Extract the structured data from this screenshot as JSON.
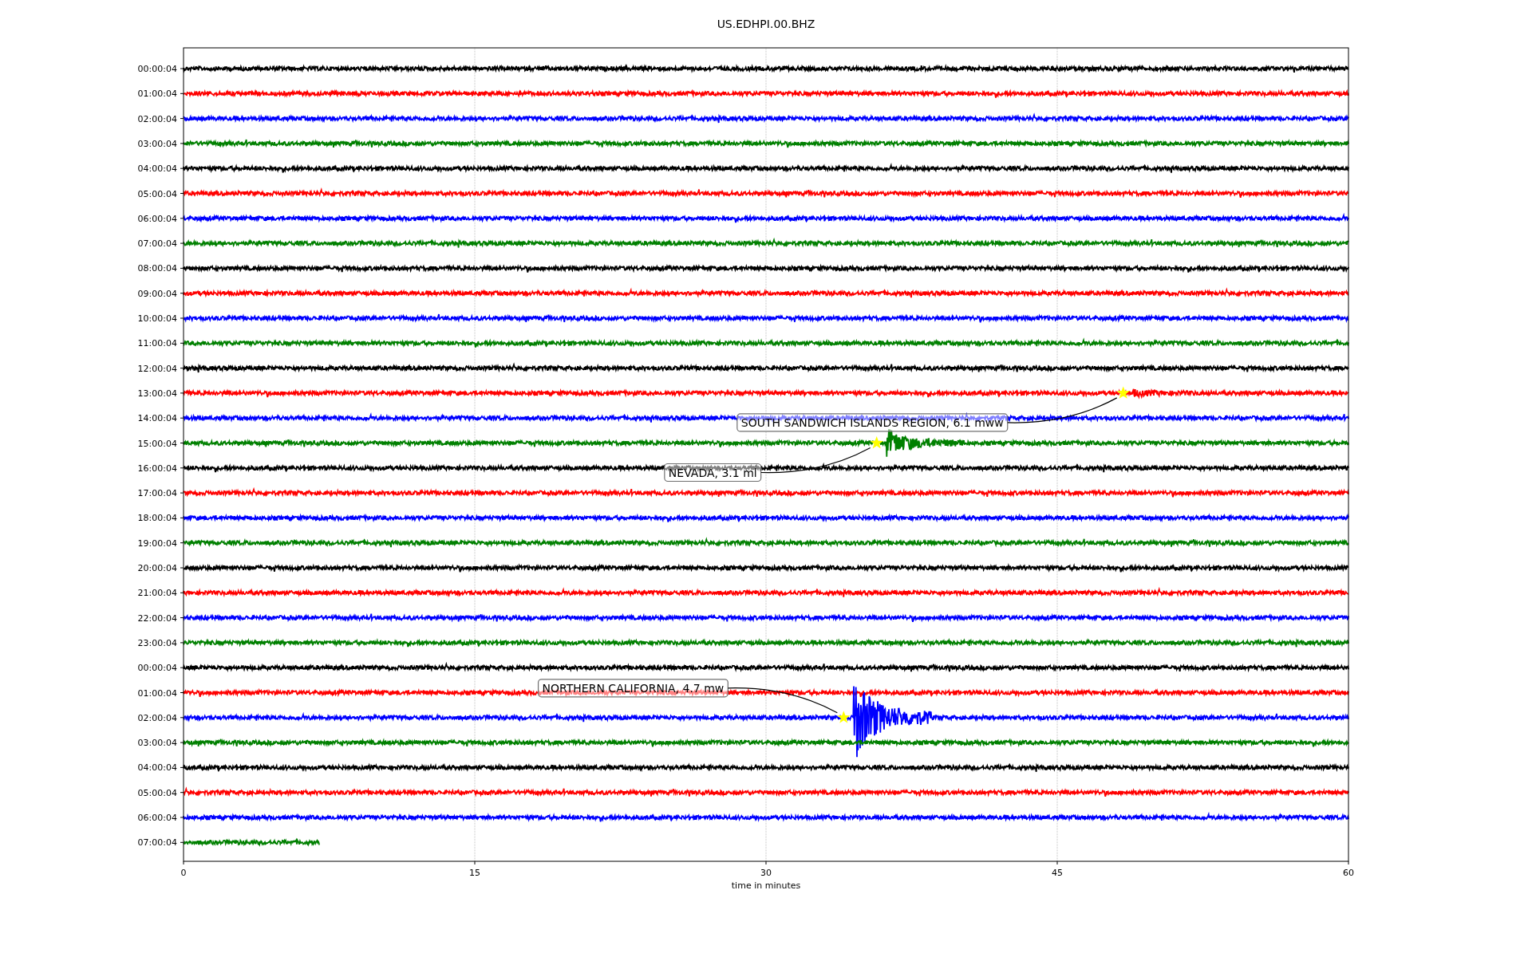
{
  "figure": {
    "title": "US.EDHPI.00.BHZ",
    "xlabel": "time in minutes",
    "xticks": [
      "0",
      "15",
      "30",
      "45",
      "60"
    ],
    "traces": [
      {
        "label": "00:00:04",
        "color": "#000000"
      },
      {
        "label": "01:00:04",
        "color": "#ff0000"
      },
      {
        "label": "02:00:04",
        "color": "#0000ff"
      },
      {
        "label": "03:00:04",
        "color": "#008000"
      },
      {
        "label": "04:00:04",
        "color": "#000000"
      },
      {
        "label": "05:00:04",
        "color": "#ff0000"
      },
      {
        "label": "06:00:04",
        "color": "#0000ff"
      },
      {
        "label": "07:00:04",
        "color": "#008000"
      },
      {
        "label": "08:00:04",
        "color": "#000000"
      },
      {
        "label": "09:00:04",
        "color": "#ff0000"
      },
      {
        "label": "10:00:04",
        "color": "#0000ff"
      },
      {
        "label": "11:00:04",
        "color": "#008000"
      },
      {
        "label": "12:00:04",
        "color": "#000000"
      },
      {
        "label": "13:00:04",
        "color": "#ff0000",
        "annotation": "SOUTH SANDWICH ISLANDS REGION, 6.1 mww"
      },
      {
        "label": "14:00:04",
        "color": "#0000ff"
      },
      {
        "label": "15:00:04",
        "color": "#008000",
        "annotation": "NEVADA, 3.1 ml"
      },
      {
        "label": "16:00:04",
        "color": "#000000"
      },
      {
        "label": "17:00:04",
        "color": "#ff0000"
      },
      {
        "label": "18:00:04",
        "color": "#0000ff"
      },
      {
        "label": "19:00:04",
        "color": "#008000"
      },
      {
        "label": "20:00:04",
        "color": "#000000"
      },
      {
        "label": "21:00:04",
        "color": "#ff0000"
      },
      {
        "label": "22:00:04",
        "color": "#0000ff"
      },
      {
        "label": "23:00:04",
        "color": "#008000"
      },
      {
        "label": "00:00:04",
        "color": "#000000"
      },
      {
        "label": "01:00:04",
        "color": "#ff0000"
      },
      {
        "label": "02:00:04",
        "color": "#0000ff",
        "annotation": "NORTHERN CALIFORNIA, 4.7 mw"
      },
      {
        "label": "03:00:04",
        "color": "#008000"
      },
      {
        "label": "04:00:04",
        "color": "#000000"
      },
      {
        "label": "05:00:04",
        "color": "#ff0000"
      },
      {
        "label": "06:00:04",
        "color": "#0000ff"
      },
      {
        "label": "07:00:04",
        "color": "#008000"
      }
    ]
  }
}
